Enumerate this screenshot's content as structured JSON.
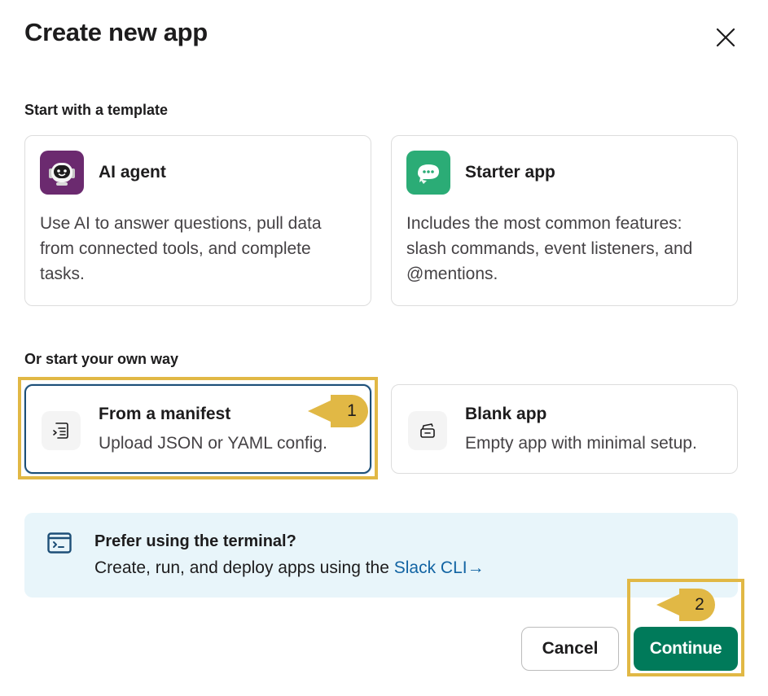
{
  "dialog": {
    "title": "Create new app",
    "close_icon": "close-icon"
  },
  "templates": {
    "label": "Start with a template",
    "items": [
      {
        "title": "AI agent",
        "description": "Use AI to answer questions, pull data from connected tools, and complete tasks.",
        "icon": "robot-icon",
        "color": "#6b2a6f"
      },
      {
        "title": "Starter app",
        "description": "Includes the most common features: slash commands, event listeners, and @mentions.",
        "icon": "chat-bubble-icon",
        "color": "#2bac76"
      }
    ]
  },
  "own_way": {
    "label": "Or start your own way",
    "items": [
      {
        "title": "From a manifest",
        "description": "Upload JSON or YAML config.",
        "icon": "manifest-icon",
        "selected": true
      },
      {
        "title": "Blank app",
        "description": "Empty app with minimal setup.",
        "icon": "blank-app-icon",
        "selected": false
      }
    ]
  },
  "terminal_banner": {
    "title": "Prefer using the terminal?",
    "text": "Create, run, and deploy apps using the ",
    "link_label": "Slack CLI",
    "link_arrow": "→",
    "icon": "terminal-icon"
  },
  "annotations": {
    "step1": "1",
    "step2": "2",
    "color": "#e1b845"
  },
  "footer": {
    "cancel_label": "Cancel",
    "continue_label": "Continue",
    "continue_color": "#007a5a"
  }
}
